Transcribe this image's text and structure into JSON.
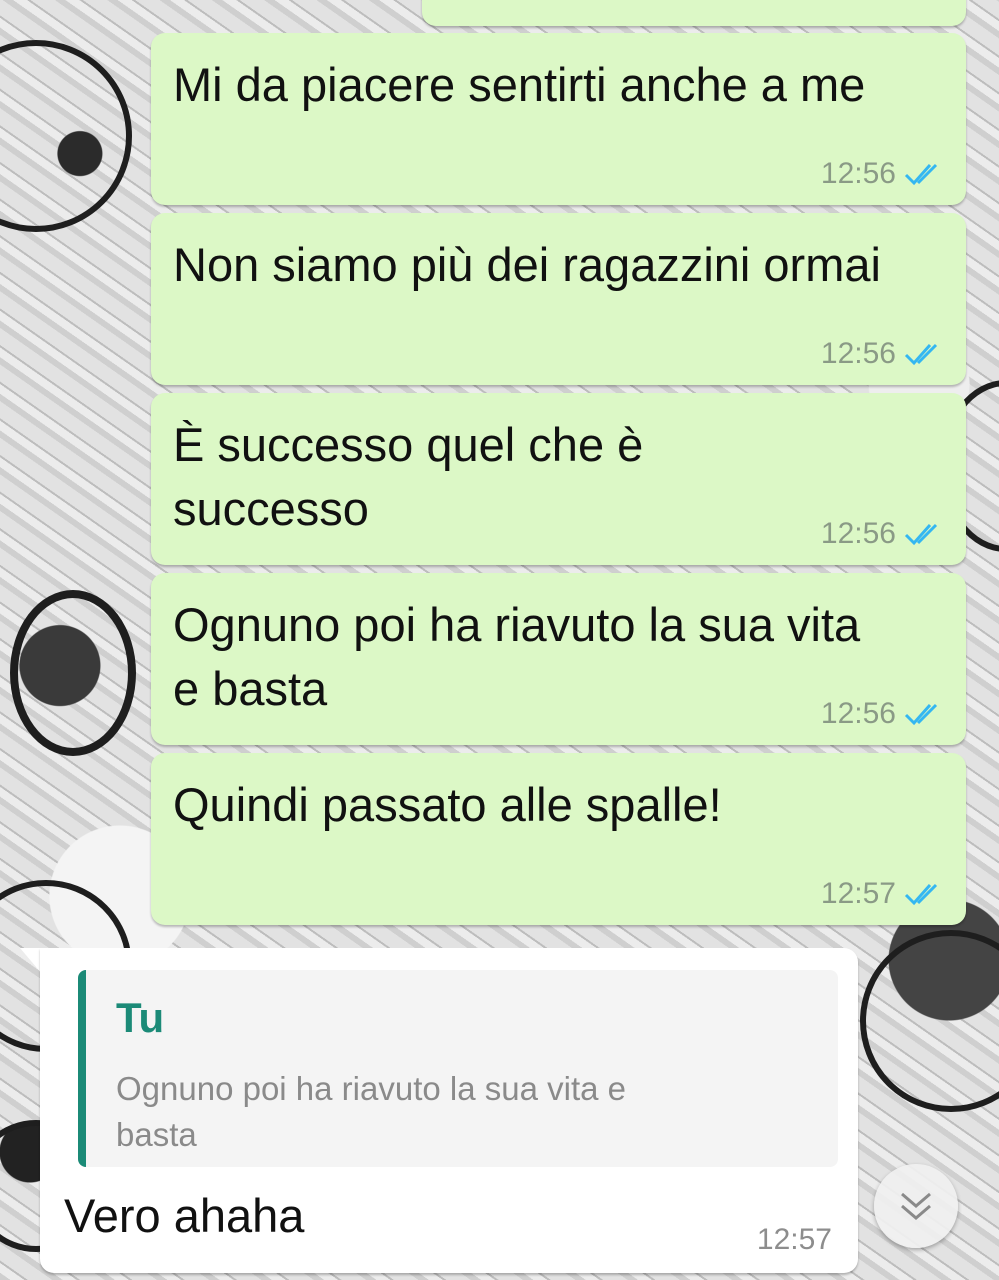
{
  "messages_outgoing": [
    {
      "text": "Mi da piacere sentirti anche a me",
      "time": "12:56"
    },
    {
      "text": "Non siamo più dei ragazzini ormai",
      "time": "12:56"
    },
    {
      "text": "È successo quel che è successo",
      "time": "12:56"
    },
    {
      "text": "Ognuno poi ha riavuto la sua vita e basta",
      "time": "12:56"
    },
    {
      "text": "Quindi passato alle spalle!",
      "time": "12:57"
    }
  ],
  "message_incoming": {
    "quote_author": "Tu",
    "quote_text": "Ognuno poi ha riavuto la sua vita e basta",
    "text": "Vero ahaha",
    "time": "12:57"
  },
  "colors": {
    "outgoing_bubble": "#dcf8c6",
    "incoming_bubble": "#ffffff",
    "quote_accent": "#1b8a77",
    "read_ticks": "#34b7f1"
  },
  "icons": {
    "read_receipt": "double-check-icon",
    "scroll_down": "double-chevron-down-icon"
  }
}
